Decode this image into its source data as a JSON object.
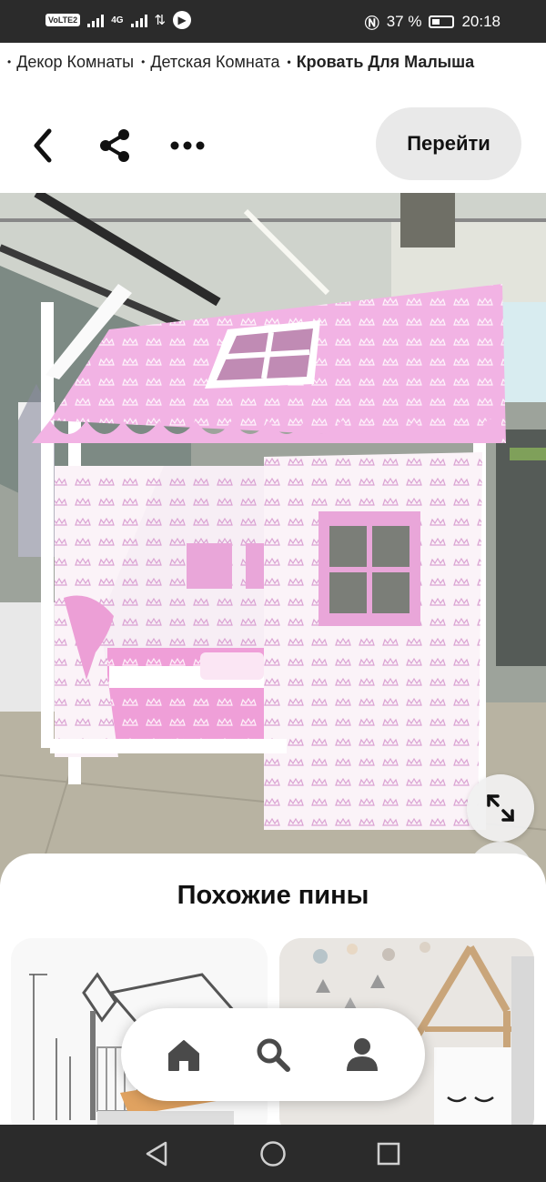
{
  "status_bar": {
    "volte": "VoLTE",
    "volte_sub": "2",
    "network": "4G",
    "battery_percent": "37 %",
    "time": "20:18"
  },
  "breadcrumbs": [
    {
      "label": "Декор Комнаты"
    },
    {
      "label": "Детская Комната"
    },
    {
      "label": "Кровать Для Малыша"
    }
  ],
  "toolbar": {
    "go_label": "Перейти"
  },
  "related": {
    "title": "Похожие пины"
  },
  "colors": {
    "status_bg": "#2b2b2b",
    "button_bg": "#e9e9e9",
    "icon_dark": "#111111",
    "nav_icon": "#4a4a4a"
  },
  "icons": {
    "back": "chevron-left-icon",
    "share": "share-icon",
    "more": "more-horizontal-icon",
    "expand": "expand-icon",
    "home": "home-icon",
    "search": "search-icon",
    "profile": "profile-icon",
    "sys_back": "triangle-back-icon",
    "sys_home": "circle-home-icon",
    "sys_recents": "square-recents-icon"
  }
}
